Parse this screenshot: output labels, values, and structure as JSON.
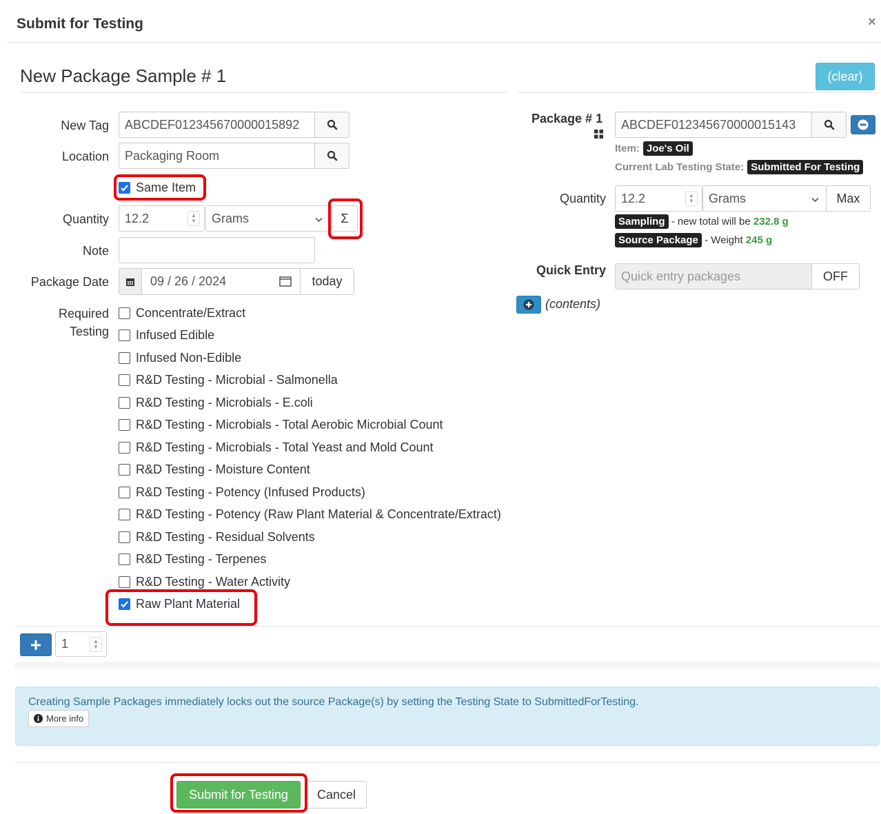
{
  "modal": {
    "title": "Submit for Testing",
    "close_glyph": "×"
  },
  "form": {
    "section_title": "New Package Sample # 1",
    "clear_label": "(clear)",
    "new_tag": {
      "label": "New Tag",
      "value": "ABCDEF012345670000015892"
    },
    "location": {
      "label": "Location",
      "value": "Packaging Room"
    },
    "same_item": {
      "label": "Same Item",
      "checked": true
    },
    "quantity": {
      "label": "Quantity",
      "value": "12.2",
      "unit": "Grams",
      "sum_glyph": "Σ"
    },
    "note": {
      "label": "Note",
      "value": ""
    },
    "package_date": {
      "label": "Package Date",
      "value": "09 / 26 / 2024",
      "today_label": "today"
    },
    "required_testing": {
      "label_line1": "Required",
      "label_line2": "Testing",
      "options": [
        {
          "label": "Concentrate/Extract",
          "checked": false
        },
        {
          "label": "Infused Edible",
          "checked": false
        },
        {
          "label": "Infused Non-Edible",
          "checked": false
        },
        {
          "label": "R&D Testing - Microbial - Salmonella",
          "checked": false
        },
        {
          "label": "R&D Testing - Microbials - E.coli",
          "checked": false
        },
        {
          "label": "R&D Testing - Microbials - Total Aerobic Microbial Count",
          "checked": false
        },
        {
          "label": "R&D Testing - Microbials - Total Yeast and Mold Count",
          "checked": false
        },
        {
          "label": "R&D Testing - Moisture Content",
          "checked": false
        },
        {
          "label": "R&D Testing - Potency (Infused Products)",
          "checked": false
        },
        {
          "label": "R&D Testing - Potency (Raw Plant Material & Concentrate/Extract)",
          "checked": false
        },
        {
          "label": "R&D Testing - Residual Solvents",
          "checked": false
        },
        {
          "label": "R&D Testing - Terpenes",
          "checked": false
        },
        {
          "label": "R&D Testing - Water Activity",
          "checked": false
        },
        {
          "label": "Raw Plant Material",
          "checked": true
        }
      ]
    },
    "add_count": "1"
  },
  "package": {
    "label": "Package # 1",
    "tag_value": "ABCDEF012345670000015143",
    "item_label": "Item:",
    "item_value": "Joe's Oil",
    "lab_state_label": "Current Lab Testing State:",
    "lab_state_value": "Submitted For Testing",
    "quantity_label": "Quantity",
    "quantity_value": "12.2",
    "quantity_unit": "Grams",
    "max_label": "Max",
    "sampling_badge": "Sampling",
    "sampling_text": "- new total will be",
    "sampling_value": "232.8 g",
    "source_badge": "Source Package",
    "source_text": "- Weight",
    "source_value": "245 g",
    "quick_entry_label": "Quick Entry",
    "quick_entry_placeholder": "Quick entry packages",
    "quick_entry_toggle": "OFF",
    "contents_label": "(contents)"
  },
  "notice": {
    "text": "Creating Sample Packages immediately locks out the source Package(s) by setting the Testing State to SubmittedForTesting.",
    "more_info_label": "More info"
  },
  "footer": {
    "submit_label": "Submit for Testing",
    "cancel_label": "Cancel"
  },
  "colors": {
    "highlight": "#e8000b",
    "info_button": "#5bc0de",
    "primary_button": "#337ab7",
    "success_button": "#5cb85c",
    "checkbox_checked": "#1a73e8"
  }
}
